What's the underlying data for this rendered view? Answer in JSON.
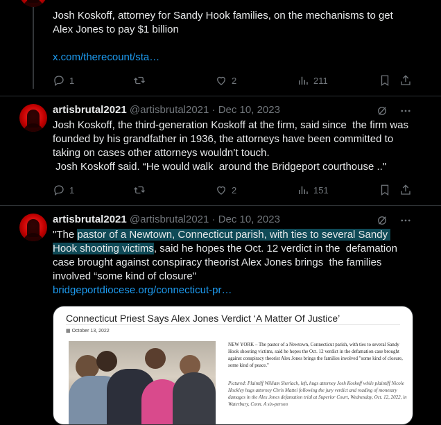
{
  "tweet1": {
    "text_top": "Josh Koskoff, attorney for Sandy Hook families, on the mechanisms to get",
    "text_line2": "Alex Jones to pay $1 billion",
    "link": "x.com/therecount/sta…",
    "replies": "1",
    "likes": "2",
    "views": "211"
  },
  "tweet2": {
    "name": "artisbrutal2021",
    "handle": "@artisbrutal2021",
    "sep": "·",
    "date": "Dec 10, 2023",
    "text": "Josh Koskoff, the third-generation Koskoff at the firm, said since  the firm was founded by his grandfather in 1936, the attorneys have been committed to taking on cases other attorneys wouldn’t touch.\n Josh Koskoff said. “He would walk  around the Bridgeport courthouse ..\"",
    "replies": "1",
    "likes": "2",
    "views": "151"
  },
  "tweet3": {
    "name": "artisbrutal2021",
    "handle": "@artisbrutal2021",
    "sep": "·",
    "date": "Dec 10, 2023",
    "text_prefix": "\"The ",
    "text_highlight": "pastor of a Newtown, Connecticut parish, with ties to several Sandy Hook shooting victims",
    "text_rest": ", said he hopes the Oct. 12 verdict in the  defamation case brought against conspiracy theorist Alex Jones brings  the families involved “some kind of closure\"",
    "link": "bridgeportdiocese.org/connecticut-pr…"
  },
  "card": {
    "title": "Connecticut Priest Says Alex Jones Verdict ‘A Matter Of Justice’",
    "date": "October 13, 2022",
    "body": "NEW YORK – The pastor of a Newtown, Connecticut parish, with ties to several Sandy Hook shooting victims, said he hopes the Oct. 12 verdict in the defamation case brought against conspiracy theorist Alex Jones brings the families involved \"some kind of closure, some kind of peace.\"",
    "caption": "Pictured: Plaintiff William Sherlach, left, hugs attorney Josh Koskoff while plaintiff Nicole Hockley hugs attorney Chris Mattei following the jury verdict and reading of monetary damages in the Alex Jones defamation trial at Superior Court, Wednesday, Oct. 12, 2022, in Waterbury, Conn. A six-person"
  },
  "colors": {
    "background": "#000000",
    "text": "#e7e9ea",
    "muted": "#71767b",
    "link": "#1d9bf0",
    "highlight": "#0f4a57"
  },
  "icons": [
    "reply-icon",
    "retweet-icon",
    "like-icon",
    "views-icon",
    "bookmark-icon",
    "share-icon",
    "grok-icon",
    "more-icon",
    "calendar-icon"
  ]
}
